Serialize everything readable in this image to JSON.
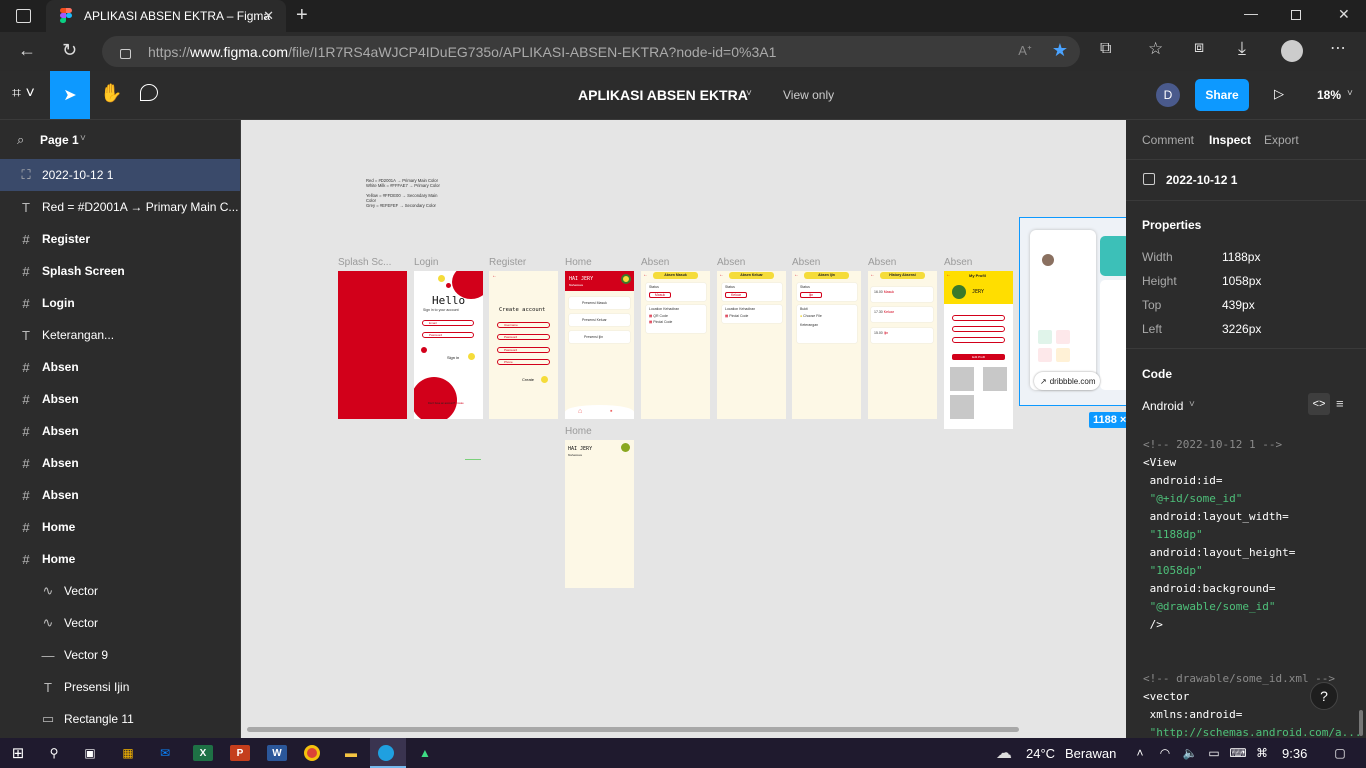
{
  "browser": {
    "tab_title": "APLIKASI ABSEN EKTRA – Figma",
    "url_prefix": "https://",
    "url_host": "www.figma.com",
    "url_path": "/file/I1R7RS4aWJCP4IDuEG735o/APLIKASI-ABSEN-EKTRA?node-id=0%3A1"
  },
  "figma": {
    "file_title": "APLIKASI ABSEN EKTRA",
    "view_mode": "View only",
    "avatar_initial": "D",
    "share_label": "Share",
    "zoom": "18%"
  },
  "left_panel": {
    "page": "Page 1",
    "layers": [
      {
        "name": "2022-10-12 1",
        "icon": "image-icon",
        "selected": true
      },
      {
        "name": "Red = #D2001A → Primary Main C...",
        "icon": "text-icon"
      },
      {
        "name": "Register",
        "icon": "frame-icon"
      },
      {
        "name": "Splash Screen",
        "icon": "frame-icon"
      },
      {
        "name": "Login",
        "icon": "frame-icon"
      },
      {
        "name": "Keterangan...",
        "icon": "text-icon"
      },
      {
        "name": "Absen",
        "icon": "frame-icon"
      },
      {
        "name": "Absen",
        "icon": "frame-icon"
      },
      {
        "name": "Absen",
        "icon": "frame-icon"
      },
      {
        "name": "Absen",
        "icon": "frame-icon"
      },
      {
        "name": "Absen",
        "icon": "frame-icon"
      },
      {
        "name": "Home",
        "icon": "frame-icon"
      },
      {
        "name": "Home",
        "icon": "frame-icon"
      },
      {
        "name": "Vector",
        "icon": "vector-icon",
        "child": true
      },
      {
        "name": "Vector",
        "icon": "vector-icon",
        "child": true
      },
      {
        "name": "Vector 9",
        "icon": "line-icon",
        "child": true
      },
      {
        "name": "Presensi Ijin",
        "icon": "text-icon",
        "child": true
      },
      {
        "name": "Rectangle 11",
        "icon": "rect-icon",
        "child": true
      }
    ]
  },
  "canvas": {
    "notes": [
      "Red = #D2001A → Primary Main Color",
      "White Milk = #FFFAE7 → Primary Color",
      "Yellow = #FFDE00 → Secondary Main",
      "Color",
      "Grey = #EFEFEF → Secondary Color"
    ],
    "frame_labels": [
      "Splash Sc...",
      "Login",
      "Register",
      "Home",
      "Absen",
      "Absen",
      "Absen",
      "Absen",
      "Absen",
      "Home"
    ],
    "login": {
      "title": "Hello",
      "subtitle": "Sign in to your account",
      "email": "Email",
      "password": "Password",
      "signin": "Sign in",
      "footer": "Don't have an account?",
      "footer_link": "Create"
    },
    "register": {
      "title": "Create account",
      "fields": [
        "Username",
        "Password",
        "Password",
        "Phone"
      ],
      "create": "Create"
    },
    "home": {
      "greeting": "HAI JERY",
      "sub": "Mahasiswa",
      "menu": [
        "Presensi Masuk",
        "Presensi Keluar",
        "Presensi Ijin"
      ]
    },
    "absen": [
      {
        "title": "Absen Masuk",
        "status_label": "Status",
        "status": "Masuk",
        "loc": "Location Kehadiran",
        "opt1": "QR Code",
        "opt2": "Pindai Code"
      },
      {
        "title": "Absen Keluar",
        "status_label": "Status",
        "status": "Keluar",
        "loc": "Location Kehadiran",
        "opt1": "Pindai Code"
      },
      {
        "title": "Absen Ijin",
        "status_label": "Status",
        "status": "Ijin",
        "loc": "Bukti",
        "opt1": "Choose File",
        "opt2": "Keterangan"
      },
      {
        "title": "History Absensi",
        "rows": [
          [
            "16.00",
            "Masuk"
          ],
          [
            "17.30",
            "Keluar"
          ],
          [
            "15.00",
            "Ijin"
          ]
        ]
      },
      {
        "title": "My Profil",
        "name": "JERY",
        "btn": "Edit Profil"
      }
    ],
    "home2": {
      "greeting": "HAI JERY",
      "sub": "Mahasiswa"
    },
    "image": {
      "source": "dribbble.com",
      "size_badge": "1188 ×"
    }
  },
  "right_panel": {
    "tabs": [
      "Comment",
      "Inspect",
      "Export"
    ],
    "active_tab": "Inspect",
    "layer_name": "2022-10-12 1",
    "properties_title": "Properties",
    "props": [
      [
        "Width",
        "1188px"
      ],
      [
        "Height",
        "1058px"
      ],
      [
        "Top",
        "439px"
      ],
      [
        "Left",
        "3226px"
      ]
    ],
    "code_title": "Code",
    "platform": "Android",
    "code_lines": [
      {
        "t": "<!-- 2022-10-12 1 -->",
        "c": "comment"
      },
      {
        "t": "<View",
        "c": "tag"
      },
      {
        "t": " android:id=",
        "c": "attr"
      },
      {
        "t": " \"@+id/some_id\"",
        "c": "str"
      },
      {
        "t": " android:layout_width=",
        "c": "attr"
      },
      {
        "t": " \"1188dp\"",
        "c": "str"
      },
      {
        "t": " android:layout_height=",
        "c": "attr"
      },
      {
        "t": " \"1058dp\"",
        "c": "str"
      },
      {
        "t": " android:background=",
        "c": "attr"
      },
      {
        "t": " \"@drawable/some_id\"",
        "c": "str"
      },
      {
        "t": " />",
        "c": "tag"
      },
      {
        "t": "",
        "c": "tag"
      },
      {
        "t": "",
        "c": "tag"
      },
      {
        "t": "<!-- drawable/some_id.xml -->",
        "c": "comment"
      },
      {
        "t": "<vector",
        "c": "tag"
      },
      {
        "t": " xmlns:android=",
        "c": "attr"
      },
      {
        "t": " \"http://schemas.android.com/a...",
        "c": "str"
      }
    ]
  },
  "taskbar": {
    "temp": "24°C",
    "weather": "Berawan",
    "time": "9:36"
  },
  "colors": {
    "accent": "#0d99ff",
    "primary_red": "#D2001A",
    "milk": "#FFFAE7",
    "yellow": "#FFDE00",
    "grey": "#EFEFEF"
  }
}
